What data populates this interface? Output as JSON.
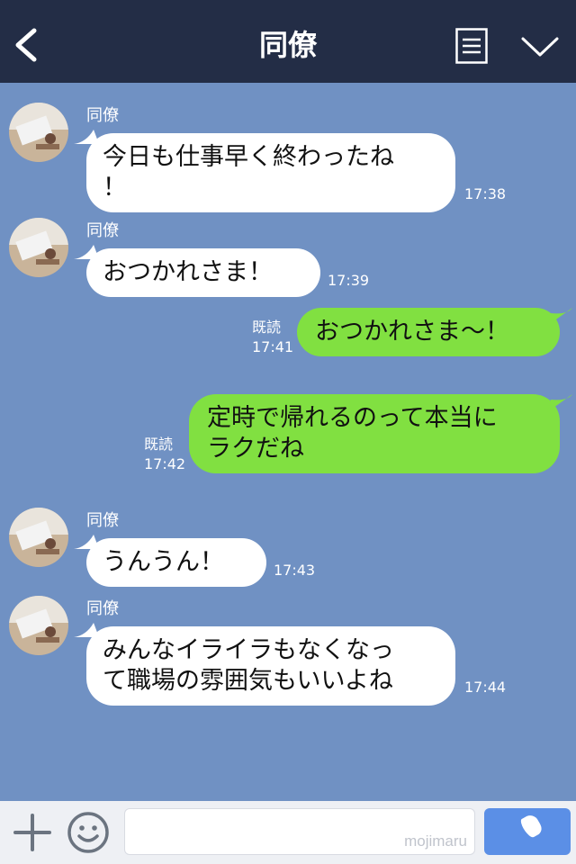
{
  "header": {
    "title": "同僚",
    "back_icon": "chevron-left-icon",
    "menu_icon": "list-menu-icon",
    "expand_icon": "chevron-down-icon"
  },
  "messages": [
    {
      "side": "in",
      "sender": "同僚",
      "lines": [
        "今日も仕事早く終わったね",
        "！"
      ],
      "time": "17:38"
    },
    {
      "side": "in",
      "sender": "同僚",
      "lines": [
        "おつかれさま！"
      ],
      "time": "17:39"
    },
    {
      "side": "out",
      "read": "既読",
      "lines": [
        "おつかれさま〜！"
      ],
      "time": "17:41"
    },
    {
      "side": "out",
      "read": "既読",
      "lines": [
        "定時で帰れるのって本当に",
        "ラクだね"
      ],
      "time": "17:42"
    },
    {
      "side": "in",
      "sender": "同僚",
      "lines": [
        "うんうん！"
      ],
      "time": "17:43"
    },
    {
      "side": "in",
      "sender": "同僚",
      "lines": [
        "みんなイライラもなくなっ",
        "て職場の雰囲気もいいよね"
      ],
      "time": "17:44"
    }
  ],
  "input": {
    "placeholder": "",
    "watermark": "mojimaru",
    "plus_icon": "plus-icon",
    "emoji_icon": "smiley-icon",
    "call_icon": "phone-icon"
  },
  "colors": {
    "header_bg": "#232d46",
    "chat_bg": "#7091c3",
    "incoming_bubble": "#ffffff",
    "outgoing_bubble": "#81e041",
    "call_button": "#5b8fe6"
  }
}
